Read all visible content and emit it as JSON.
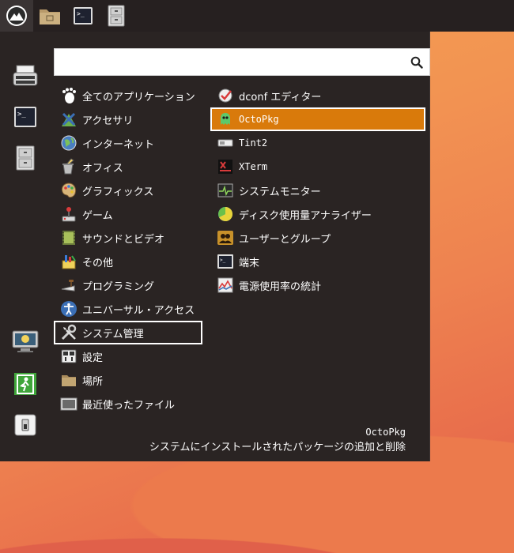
{
  "taskbar": {
    "buttons": [
      {
        "name": "app-menu-button",
        "icon": "mountain-logo-icon"
      },
      {
        "name": "file-manager-button",
        "icon": "folder-icon"
      },
      {
        "name": "terminal-button",
        "icon": "terminal-icon"
      },
      {
        "name": "file-cabinet-button",
        "icon": "file-cabinet-icon"
      }
    ]
  },
  "sidebar": {
    "favorites": [
      {
        "icon": "typewriter-icon"
      },
      {
        "icon": "terminal-icon"
      },
      {
        "icon": "file-cabinet-icon"
      }
    ],
    "session": [
      {
        "icon": "lock-screen-icon"
      },
      {
        "icon": "logout-icon"
      },
      {
        "icon": "shutdown-icon"
      }
    ]
  },
  "search": {
    "value": "",
    "placeholder": ""
  },
  "categories": [
    {
      "label": "全てのアプリケーション",
      "icon": "gnome-foot-icon"
    },
    {
      "label": "アクセサリ",
      "icon": "accessories-icon"
    },
    {
      "label": "インターネット",
      "icon": "globe-icon"
    },
    {
      "label": "オフィス",
      "icon": "office-icon"
    },
    {
      "label": "グラフィックス",
      "icon": "palette-icon"
    },
    {
      "label": "ゲーム",
      "icon": "joystick-icon"
    },
    {
      "label": "サウンドとビデオ",
      "icon": "film-icon"
    },
    {
      "label": "その他",
      "icon": "misc-icon"
    },
    {
      "label": "プログラミング",
      "icon": "trowel-icon"
    },
    {
      "label": "ユニバーサル・アクセス",
      "icon": "accessibility-icon"
    },
    {
      "label": "システム管理",
      "icon": "tools-icon"
    },
    {
      "label": "設定",
      "icon": "settings-icon"
    },
    {
      "label": "場所",
      "icon": "folder-icon"
    },
    {
      "label": "最近使ったファイル",
      "icon": "recent-files-icon"
    }
  ],
  "apps": [
    {
      "label": "dconf エディター",
      "icon": "dconf-icon"
    },
    {
      "label": "OctoPkg",
      "icon": "octopkg-icon"
    },
    {
      "label": "Tint2",
      "icon": "tint2-icon"
    },
    {
      "label": "XTerm",
      "icon": "xterm-icon"
    },
    {
      "label": "システムモニター",
      "icon": "system-monitor-icon"
    },
    {
      "label": "ディスク使用量アナライザー",
      "icon": "disk-usage-icon"
    },
    {
      "label": "ユーザーとグループ",
      "icon": "users-icon"
    },
    {
      "label": "端末",
      "icon": "terminal-icon"
    },
    {
      "label": "電源使用率の統計",
      "icon": "power-stats-icon"
    }
  ],
  "description": {
    "name": "OctoPkg",
    "text": "システムにインストールされたパッケージの追加と削除"
  },
  "colors": {
    "selected": "#d97a0b",
    "menu_bg": "#2a2423",
    "taskbar_bg": "#262020"
  }
}
